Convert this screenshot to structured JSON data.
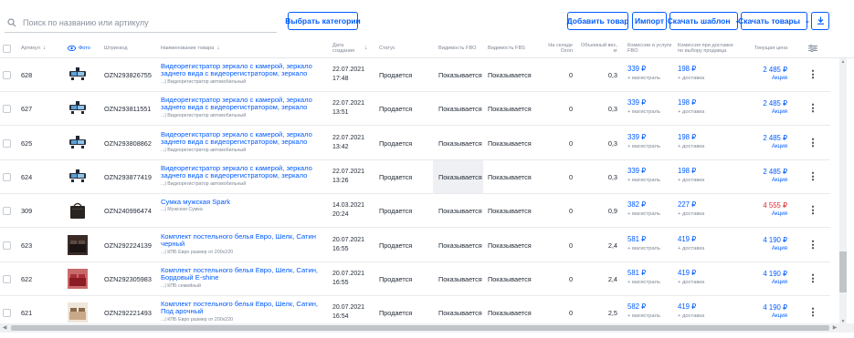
{
  "toolbar": {
    "search_placeholder": "Поиск по названию или артикулу",
    "choose_categories": "Выбрать категории",
    "add_product": "Добавить товар",
    "import": "Импорт",
    "download_template": "Скачать шаблон",
    "download_products": "Скачать товары"
  },
  "headers": {
    "article": "Артикул",
    "photo": "Фото",
    "barcode": "Штрихкод",
    "name": "Наименование товара",
    "created": "Дата создания",
    "status": "Статус",
    "fbo": "Видимость FBO",
    "fbs": "Видимость FBS",
    "stock": "На складе Ozon",
    "volume": "Объемный вес, кг",
    "commission_fbo": "Комиссии и услуги FBO",
    "commission_delivery": "Комиссия при доставке по выбору продавца",
    "price": "Текущая цена"
  },
  "labels": {
    "plus_highway": "+ магистраль",
    "plus_delivery": "+ доставка",
    "promo": "Акция"
  },
  "rows": [
    {
      "article": "628",
      "barcode": "OZN293826755",
      "title": "Видеорегистратор зеркало с камерой, зеркало заднего вида с видеорегистратором, зеркало видеорегистратор",
      "category": "...| Видеорегистратор автомобильный",
      "date": "22.07.2021",
      "time": "17:48",
      "status": "Продается",
      "fbo": "Показывается",
      "fbs": "Показывается",
      "stock": "0",
      "volume": "0,3",
      "commission": "339 ₽",
      "delivery": "198 ₽",
      "price": "2 485 ₽",
      "price_color": "#005bff",
      "thumb": "dashcam"
    },
    {
      "article": "627",
      "barcode": "OZN293811551",
      "title": "Видеорегистратор зеркало с камерой, зеркало заднего вида с видеорегистратором, зеркало видеорегистратор",
      "category": "...| Видеорегистратор автомобильный",
      "date": "22.07.2021",
      "time": "13:51",
      "status": "Продается",
      "fbo": "Показывается",
      "fbs": "Показывается",
      "stock": "0",
      "volume": "0,3",
      "commission": "339 ₽",
      "delivery": "198 ₽",
      "price": "2 485 ₽",
      "price_color": "#005bff",
      "thumb": "dashcam"
    },
    {
      "article": "625",
      "barcode": "OZN293808862",
      "title": "Видеорегистратор зеркало с камерой, зеркало заднего вида с видеорегистратором, зеркало видеорегистратор",
      "category": "...| Видеорегистратор автомобильный",
      "date": "22.07.2021",
      "time": "13:42",
      "status": "Продается",
      "fbo": "Показывается",
      "fbs": "Показывается",
      "stock": "0",
      "volume": "0,3",
      "commission": "339 ₽",
      "delivery": "198 ₽",
      "price": "2 485 ₽",
      "price_color": "#005bff",
      "thumb": "dashcam"
    },
    {
      "article": "624",
      "barcode": "OZN293877419",
      "title": "Видеорегистратор зеркало с камерой, зеркало заднего вида с видеорегистратором, зеркало видеорегистратор",
      "category": "...| Видеорегистратор автомобильный",
      "date": "22.07.2021",
      "time": "13:26",
      "status": "Продается",
      "fbo": "Показывается",
      "fbs": "Показывается",
      "stock": "0",
      "volume": "0,3",
      "commission": "339 ₽",
      "delivery": "198 ₽",
      "price": "2 485 ₽",
      "price_color": "#005bff",
      "thumb": "dashcam",
      "highlight": true
    },
    {
      "article": "309",
      "barcode": "OZN240996474",
      "title": "Сумка мужская Spark",
      "category": "...| Мужская Сумка",
      "date": "14.03.2021",
      "time": "20:24",
      "status": "Продается",
      "fbo": "Показывается",
      "fbs": "Показывается",
      "stock": "0",
      "volume": "0,9",
      "commission": "382 ₽",
      "delivery": "227 ₽",
      "price": "4 555 ₽",
      "price_color": "#e0292f",
      "thumb": "bag"
    },
    {
      "article": "623",
      "barcode": "OZN292224139",
      "title": "Комплект постельного белья Евро, Шелк, Сатин черный",
      "category": "...| КПБ Евро размер от 200х220",
      "date": "20.07.2021",
      "time": "16:55",
      "status": "Продается",
      "fbo": "Показывается",
      "fbs": "Показывается",
      "stock": "0",
      "volume": "2,4",
      "commission": "581 ₽",
      "delivery": "419 ₽",
      "price": "4 190 ₽",
      "price_color": "#005bff",
      "thumb": "bed-dark"
    },
    {
      "article": "622",
      "barcode": "OZN292305983",
      "title": "Комплект постельного белья Евро, Шелк, Сатин, Бордовый E-shine",
      "category": "...| КПБ семейный",
      "date": "20.07.2021",
      "time": "16:55",
      "status": "Продается",
      "fbo": "Показывается",
      "fbs": "Показывается",
      "stock": "0",
      "volume": "2,4",
      "commission": "581 ₽",
      "delivery": "419 ₽",
      "price": "4 190 ₽",
      "price_color": "#005bff",
      "thumb": "bed-red"
    },
    {
      "article": "621",
      "barcode": "OZN292221493",
      "title": "Комплект постельного белья Евро, Шелк, Сатин, Под арочный",
      "category": "...| КПБ Евро размер от 200х220",
      "date": "20.07.2021",
      "time": "16:54",
      "status": "Продается",
      "fbo": "Показывается",
      "fbs": "Показывается",
      "stock": "0",
      "volume": "2,5",
      "commission": "582 ₽",
      "delivery": "419 ₽",
      "price": "4 190 ₽",
      "price_color": "#005bff",
      "thumb": "bed-beige"
    }
  ],
  "icons": {
    "search": "search-icon",
    "eye": "eye-icon",
    "sort": "sort-arrow-icon",
    "settings": "column-settings-icon",
    "more": "more-vertical-icon",
    "export": "export-download-icon"
  }
}
